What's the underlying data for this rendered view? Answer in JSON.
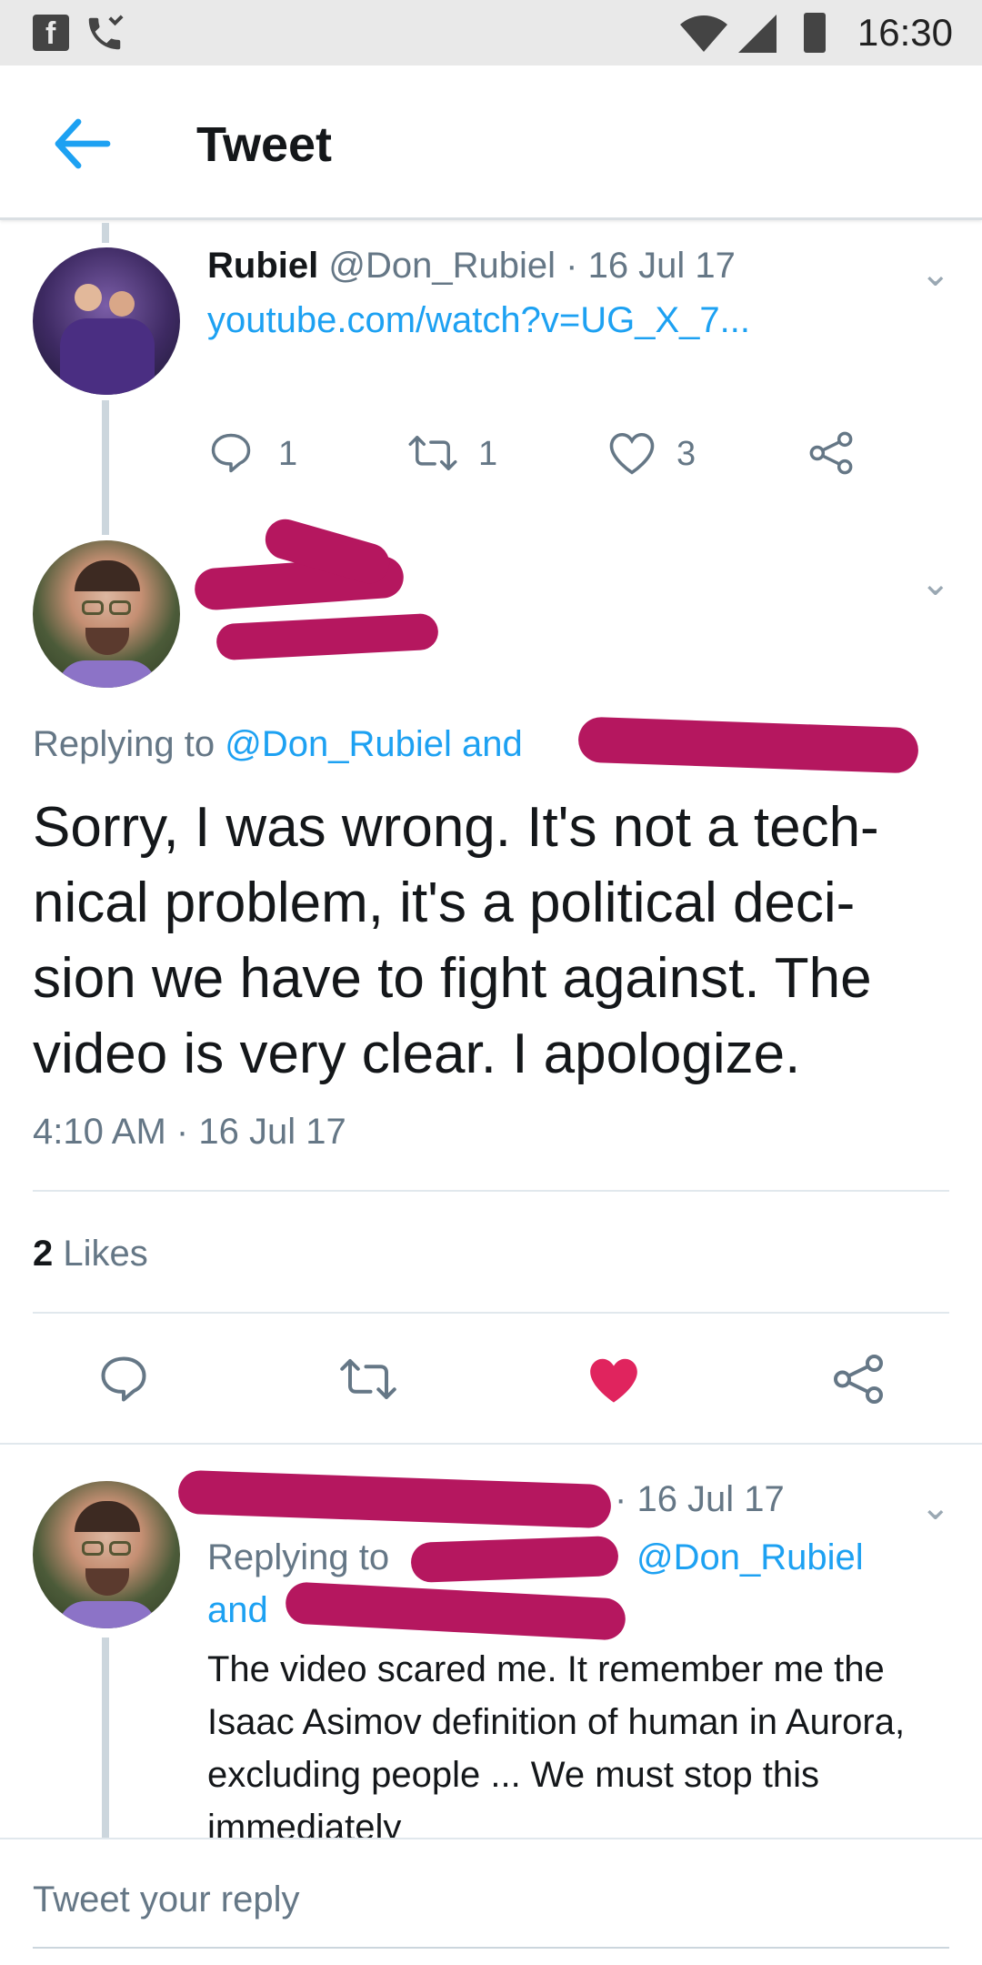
{
  "status_bar": {
    "time": "16:30"
  },
  "app_bar": {
    "title": "Tweet"
  },
  "parent_tweet": {
    "display_name": "Rubiel",
    "handle": "@Don_Rubiel",
    "dot": "·",
    "date": "16 Jul 17",
    "link_text": "youtube.com/watch?v=UG_X_7...",
    "reply_count": "1",
    "retweet_count": "1",
    "like_count": "3"
  },
  "main_tweet": {
    "replying_to_label": "Replying to",
    "replying_to_user": "@Don_Rubiel",
    "replying_to_and": "and",
    "text": "Sorry, I was wrong. It's not a tech-nical problem, it's a political deci-sion we have to fight against. The video is very clear. I apologize.",
    "time": "4:10 AM",
    "dot": "·",
    "date": "16 Jul 17",
    "likes_count": "2",
    "likes_label": "Likes",
    "liked": true,
    "like_color": "#e0245e"
  },
  "reply_tweet": {
    "dot": "·",
    "date": "16 Jul 17",
    "replying_to_label": "Replying to",
    "replying_to_user": "@Don_Rubiel",
    "replying_to_and": "and",
    "text": "The video scared me. It remember me the Isaac Asimov definition of human in Aurora, excluding people ... We must stop this immediately"
  },
  "composer": {
    "placeholder": "Tweet your reply"
  },
  "colors": {
    "accent": "#1da1f2",
    "redaction": "#b5175f"
  }
}
